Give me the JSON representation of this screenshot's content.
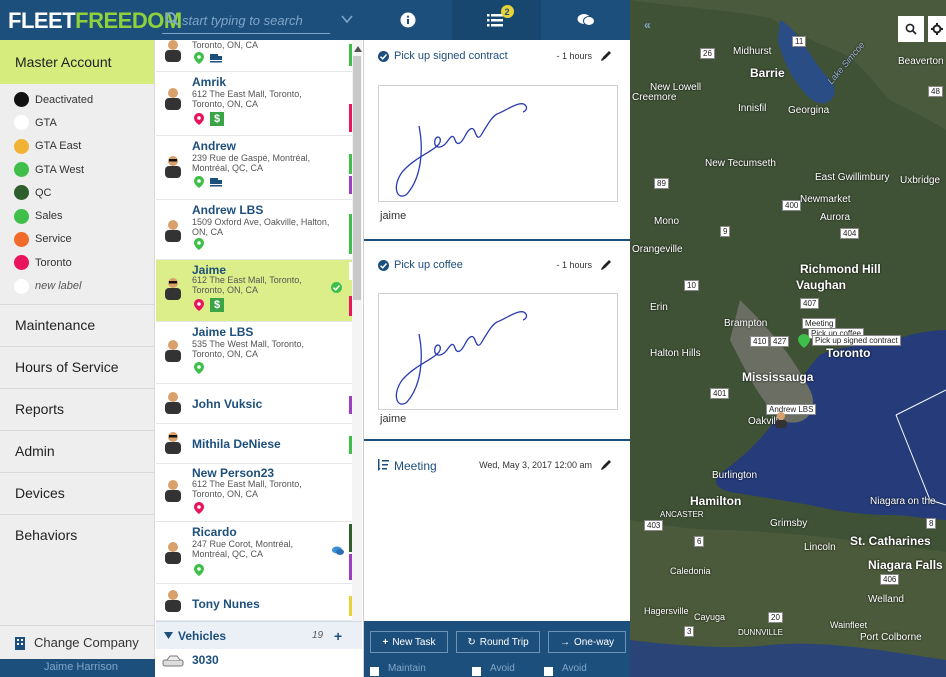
{
  "app": {
    "logo_a": "FLEET",
    "logo_b": "FREEDOM",
    "search_placeholder": "start typing to search"
  },
  "tabs": [
    {
      "name": "info",
      "badge": ""
    },
    {
      "name": "tasks",
      "badge": "2"
    },
    {
      "name": "chat",
      "badge": ""
    }
  ],
  "leftnav": {
    "master": "Master Account",
    "labels": [
      {
        "name": "Deactivated",
        "color": "#111111"
      },
      {
        "name": "GTA",
        "color": "#ffffff"
      },
      {
        "name": "GTA East",
        "color": "#f2b233"
      },
      {
        "name": "GTA West",
        "color": "#3fbf4a"
      },
      {
        "name": "QC",
        "color": "#2e5e2c"
      },
      {
        "name": "Sales",
        "color": "#3fbf4a"
      },
      {
        "name": "Service",
        "color": "#f26b2a"
      },
      {
        "name": "Toronto",
        "color": "#e8155d"
      }
    ],
    "new_label": "new label",
    "items": [
      "Maintenance",
      "Hours of Service",
      "Reports",
      "Admin",
      "Devices",
      "Behaviors"
    ],
    "change_company": "Change Company",
    "user": "Jaime Harrison"
  },
  "drivers": [
    {
      "name": "",
      "addr": "Toronto, ON, CA",
      "stripe": "#3fbf4a"
    },
    {
      "name": "Amrik",
      "addr": "612 The East Mall, Toronto, Toronto, ON, CA",
      "stripe": "#e8155d"
    },
    {
      "name": "Andrew",
      "addr": "239 Rue de Gaspé, Montréal, Montréal, QC, CA",
      "stripe": "#3fbf4a"
    },
    {
      "name": "Andrew LBS",
      "addr": "1509 Oxford Ave, Oakville, Halton, ON, CA",
      "stripe": "#3fbf4a"
    },
    {
      "name": "Jaime",
      "addr": "612 The East Mall, Toronto, Toronto, ON, CA",
      "stripe": "#e8155d"
    },
    {
      "name": "Jaime LBS",
      "addr": "535 The West Mall, Toronto, Toronto, ON, CA",
      "stripe": "#ffffff"
    },
    {
      "name": "John Vuksic",
      "addr": "",
      "stripe": "#9b3fbf"
    },
    {
      "name": "Mithila DeNiese",
      "addr": "",
      "stripe": "#3fbf4a"
    },
    {
      "name": "New Person23",
      "addr": "612 The East Mall, Toronto, Toronto, ON, CA",
      "stripe": "#ffffff"
    },
    {
      "name": "Ricardo",
      "addr": "247 Rue Corot, Montréal, Montréal, QC, CA",
      "stripe": "#9b3fbf"
    },
    {
      "name": "Tony Nunes",
      "addr": "",
      "stripe": "#e8d23a"
    }
  ],
  "vehicles": {
    "label": "Vehicles",
    "count": "19",
    "first": "3030"
  },
  "tasks": [
    {
      "title": "Pick up signed contract",
      "time": "- 1 hours",
      "signer": "jaime"
    },
    {
      "title": "Pick up coffee",
      "time": "- 1 hours",
      "signer": "jaime"
    },
    {
      "title": "Meeting",
      "time": "Wed, May 3, 2017 12:00 am",
      "signer": ""
    }
  ],
  "task_actions": {
    "new_task": "New Task",
    "round_trip": "Round Trip",
    "one_way": "One-way"
  },
  "task_options": [
    "Maintain",
    "Avoid",
    "Avoid"
  ],
  "map": {
    "labels": [
      {
        "t": "Midhurst"
      },
      {
        "t": "Barrie"
      },
      {
        "t": "New Lowell"
      },
      {
        "t": "Creemore"
      },
      {
        "t": "Innisfil"
      },
      {
        "t": "Georgina"
      },
      {
        "t": "Beaverton"
      },
      {
        "t": "New Tecumseth"
      },
      {
        "t": "East Gwillimbury"
      },
      {
        "t": "Newmarket"
      },
      {
        "t": "Uxbridge"
      },
      {
        "t": "Mono"
      },
      {
        "t": "Aurora"
      },
      {
        "t": "Orangeville"
      },
      {
        "t": "Richmond Hill"
      },
      {
        "t": "Vaughan"
      },
      {
        "t": "Erin"
      },
      {
        "t": "Brampton"
      },
      {
        "t": "Halton Hills"
      },
      {
        "t": "Toronto"
      },
      {
        "t": "Mississauga"
      },
      {
        "t": "Oakville"
      },
      {
        "t": "Burlington"
      },
      {
        "t": "Hamilton"
      },
      {
        "t": "ANCASTER"
      },
      {
        "t": "Grimsby"
      },
      {
        "t": "St. Catharines"
      },
      {
        "t": "Lincoln"
      },
      {
        "t": "Niagara Falls"
      },
      {
        "t": "Caledonia"
      },
      {
        "t": "Welland"
      },
      {
        "t": "Hagersville"
      },
      {
        "t": "Cayuga"
      },
      {
        "t": "DUNNVILLE"
      },
      {
        "t": "Wainfleet"
      },
      {
        "t": "Port Colborne"
      },
      {
        "t": "Niagara on the"
      },
      {
        "t": "Lake Simcoe"
      }
    ],
    "tags": [
      "Meeting",
      "Pick up coffee",
      "Pick up signed contract",
      "Andrew LBS"
    ],
    "roads": [
      "26",
      "11",
      "48",
      "89",
      "400",
      "404",
      "9",
      "10",
      "410",
      "427",
      "401",
      "407",
      "403",
      "6",
      "406",
      "3",
      "20",
      "8"
    ]
  }
}
